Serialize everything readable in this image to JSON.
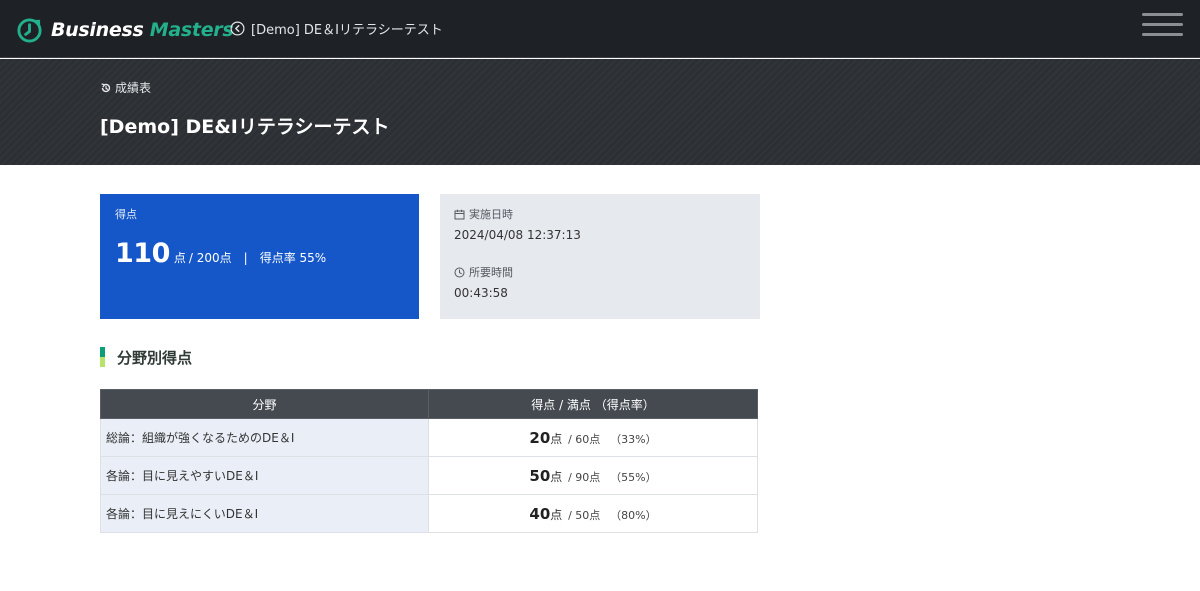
{
  "header": {
    "brand": {
      "word1": "Business",
      "word2": "Masters"
    },
    "back_label": "[Demo] DE＆Iリテラシーテスト"
  },
  "hero": {
    "breadcrumb": "成績表",
    "title": "[Demo] DE&Iリテラシーテスト"
  },
  "score_card": {
    "label": "得点",
    "score": "110",
    "unit": "点",
    "total": "/ 200点",
    "separator": "|",
    "rate": "得点率 55%"
  },
  "time_card": {
    "date_label": "実施日時",
    "date_value": "2024/04/08 12:37:13",
    "duration_label": "所要時間",
    "duration_value": "00:43:58"
  },
  "section": {
    "title": "分野別得点"
  },
  "table": {
    "headers": [
      "分野",
      "得点 / 満点 （得点率）"
    ],
    "rows": [
      {
        "field": "総論：組織が強くなるためのDE＆I",
        "score": "20",
        "unit": "点",
        "total": "/ 60点",
        "rate": "（33%）"
      },
      {
        "field": "各論：目に見えやすいDE＆I",
        "score": "50",
        "unit": "点",
        "total": "/ 90点",
        "rate": "（55%）"
      },
      {
        "field": "各論：目に見えにくいDE＆I",
        "score": "40",
        "unit": "点",
        "total": "/ 50点",
        "rate": "（80%）"
      }
    ]
  },
  "colors": {
    "nav_bg": "#1e2125",
    "hero_bg": "#2c2f33",
    "brand_accent": "#23b08c",
    "score_card_bg": "#1557c9",
    "time_card_bg": "#e6e9ee",
    "table_header_bg": "#454a51",
    "section_bar_top": "#0c9e78",
    "section_bar_bottom": "#b8e36b"
  },
  "icons": {
    "brand": "business-masters-logo-icon",
    "back": "back-arrow-circle-icon",
    "menu": "hamburger-menu-icon",
    "breadcrumb": "history-icon",
    "date": "calendar-icon",
    "duration": "clock-icon"
  }
}
